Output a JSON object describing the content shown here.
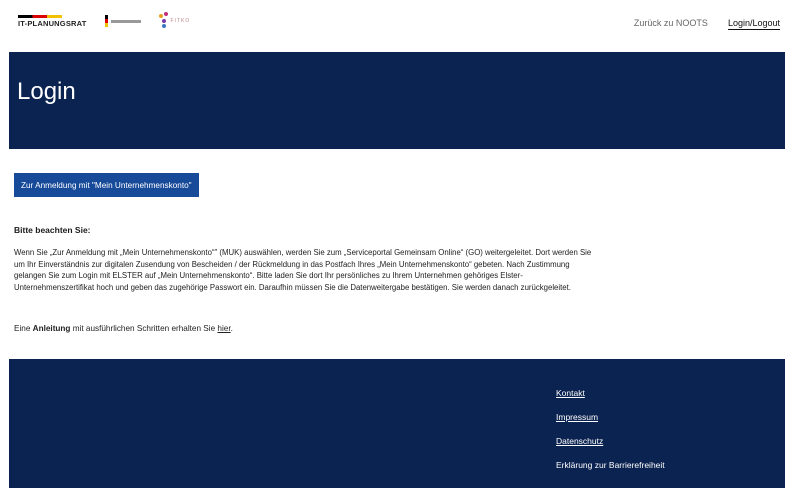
{
  "header": {
    "logos": {
      "itplanungsrat": "IT-PLANUNGSRAT",
      "fitko": "FITKO"
    },
    "nav": [
      {
        "label": "Zurück zu NOOTS"
      },
      {
        "label": "Login/Logout"
      }
    ]
  },
  "hero": {
    "title": "Login"
  },
  "cta": {
    "label": "Zur Anmeldung mit \"Mein Unternehmenskonto\""
  },
  "notice": {
    "title": "Bitte beachten Sie:",
    "text": "Wenn Sie „Zur Anmeldung mit „Mein Unternehmenskonto“\" (MUK) auswählen, werden Sie zum „Serviceportal Gemeinsam Online“ (GO) weitergeleitet. Dort werden Sie um Ihr Einverständnis zur digitalen Zusendung von Bescheiden / der Rückmeldung in das Postfach Ihres „Mein Unternehmenskonto“ gebeten. Nach Zustimmung gelangen Sie zum Login mit ELSTER auf „Mein Unternehmenskonto“. Bitte laden Sie dort Ihr persönliches zu Ihrem Unternehmen gehöriges Elster-Unternehmenszertifikat hoch und geben das zugehörige Passwort ein. Daraufhin müssen Sie die Datenweitergabe bestätigen. Sie werden danach zurückgeleitet."
  },
  "guide": {
    "prefix": "Eine ",
    "bold": "Anleitung",
    "middle": " mit ausführlichen Schritten erhalten Sie ",
    "link": "hier",
    "suffix": "."
  },
  "footer": {
    "links": [
      {
        "label": "Kontakt"
      },
      {
        "label": "Impressum"
      },
      {
        "label": "Datenschutz"
      },
      {
        "label": "Erklärung zur Barrierefreiheit"
      }
    ]
  },
  "colors": {
    "navy": "#0b2350",
    "button_blue": "#174a99"
  }
}
